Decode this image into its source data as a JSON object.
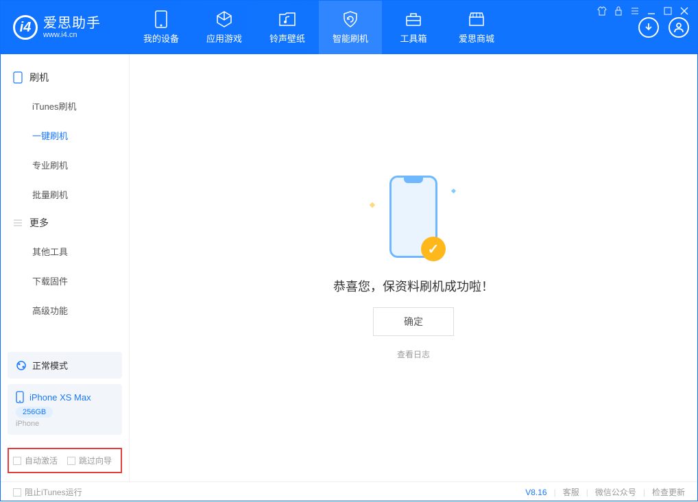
{
  "logo": {
    "title": "爱思助手",
    "url": "www.i4.cn"
  },
  "nav": {
    "device": "我的设备",
    "apps": "应用游戏",
    "ringtone": "铃声壁纸",
    "flash": "智能刷机",
    "toolbox": "工具箱",
    "store": "爱思商城"
  },
  "sidebar": {
    "section_flash": "刷机",
    "itunes_flash": "iTunes刷机",
    "oneclick_flash": "一键刷机",
    "pro_flash": "专业刷机",
    "batch_flash": "批量刷机",
    "section_more": "更多",
    "other_tools": "其他工具",
    "download_fw": "下载固件",
    "advanced": "高级功能"
  },
  "mode_panel": {
    "label": "正常模式"
  },
  "device_panel": {
    "name": "iPhone XS Max",
    "storage": "256GB",
    "type": "iPhone"
  },
  "checkboxes": {
    "auto_activate": "自动激活",
    "skip_guide": "跳过向导"
  },
  "main": {
    "success": "恭喜您，保资料刷机成功啦！",
    "confirm": "确定",
    "view_log": "查看日志"
  },
  "footer": {
    "block_itunes": "阻止iTunes运行",
    "version": "V8.16",
    "support": "客服",
    "wechat": "微信公众号",
    "check_update": "检查更新"
  }
}
